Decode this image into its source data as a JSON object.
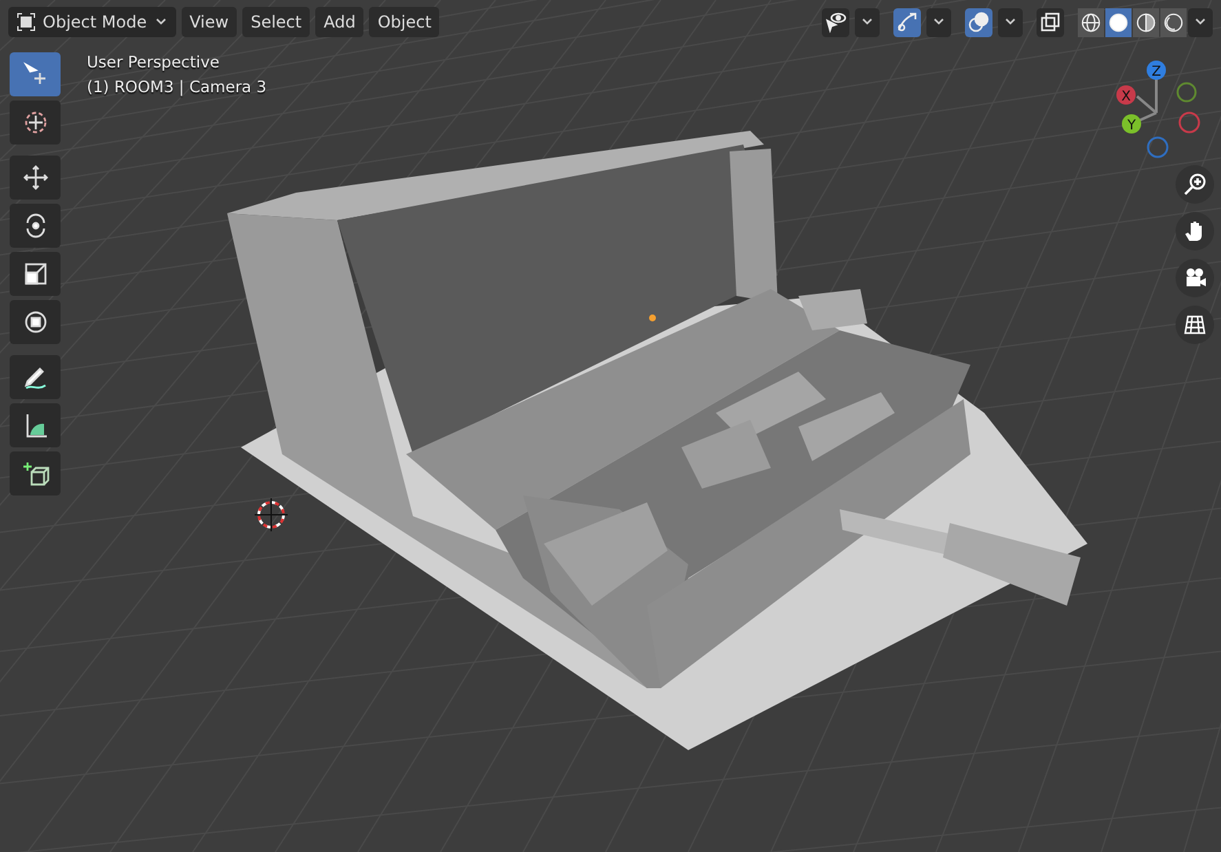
{
  "header": {
    "mode": "Object Mode",
    "menus": [
      "View",
      "Select",
      "Add",
      "Object"
    ],
    "toggles": [
      {
        "kind": "visibility",
        "selected": false
      },
      {
        "kind": "gizmo",
        "selected": true
      },
      {
        "kind": "overlay",
        "selected": true
      },
      {
        "kind": "xray",
        "selected": false
      }
    ],
    "shading": [
      {
        "kind": "wireframe",
        "selected": false
      },
      {
        "kind": "solid",
        "selected": true
      },
      {
        "kind": "material",
        "selected": false
      },
      {
        "kind": "rendered",
        "selected": false
      }
    ]
  },
  "viewport_info": [
    "User Perspective",
    "(1) ROOM3 | Camera 3"
  ],
  "toolbar": [
    {
      "kind": "select",
      "selected": true
    },
    {
      "kind": "cursor",
      "selected": false
    },
    {
      "kind": "move",
      "selected": false
    },
    {
      "kind": "rotate",
      "selected": false
    },
    {
      "kind": "scale",
      "selected": false
    },
    {
      "kind": "transform",
      "selected": false
    },
    {
      "kind": "annotate",
      "selected": false
    },
    {
      "kind": "measure",
      "selected": false
    },
    {
      "kind": "add-cube",
      "selected": false
    }
  ],
  "axes": [
    "X",
    "Y",
    "Z"
  ]
}
